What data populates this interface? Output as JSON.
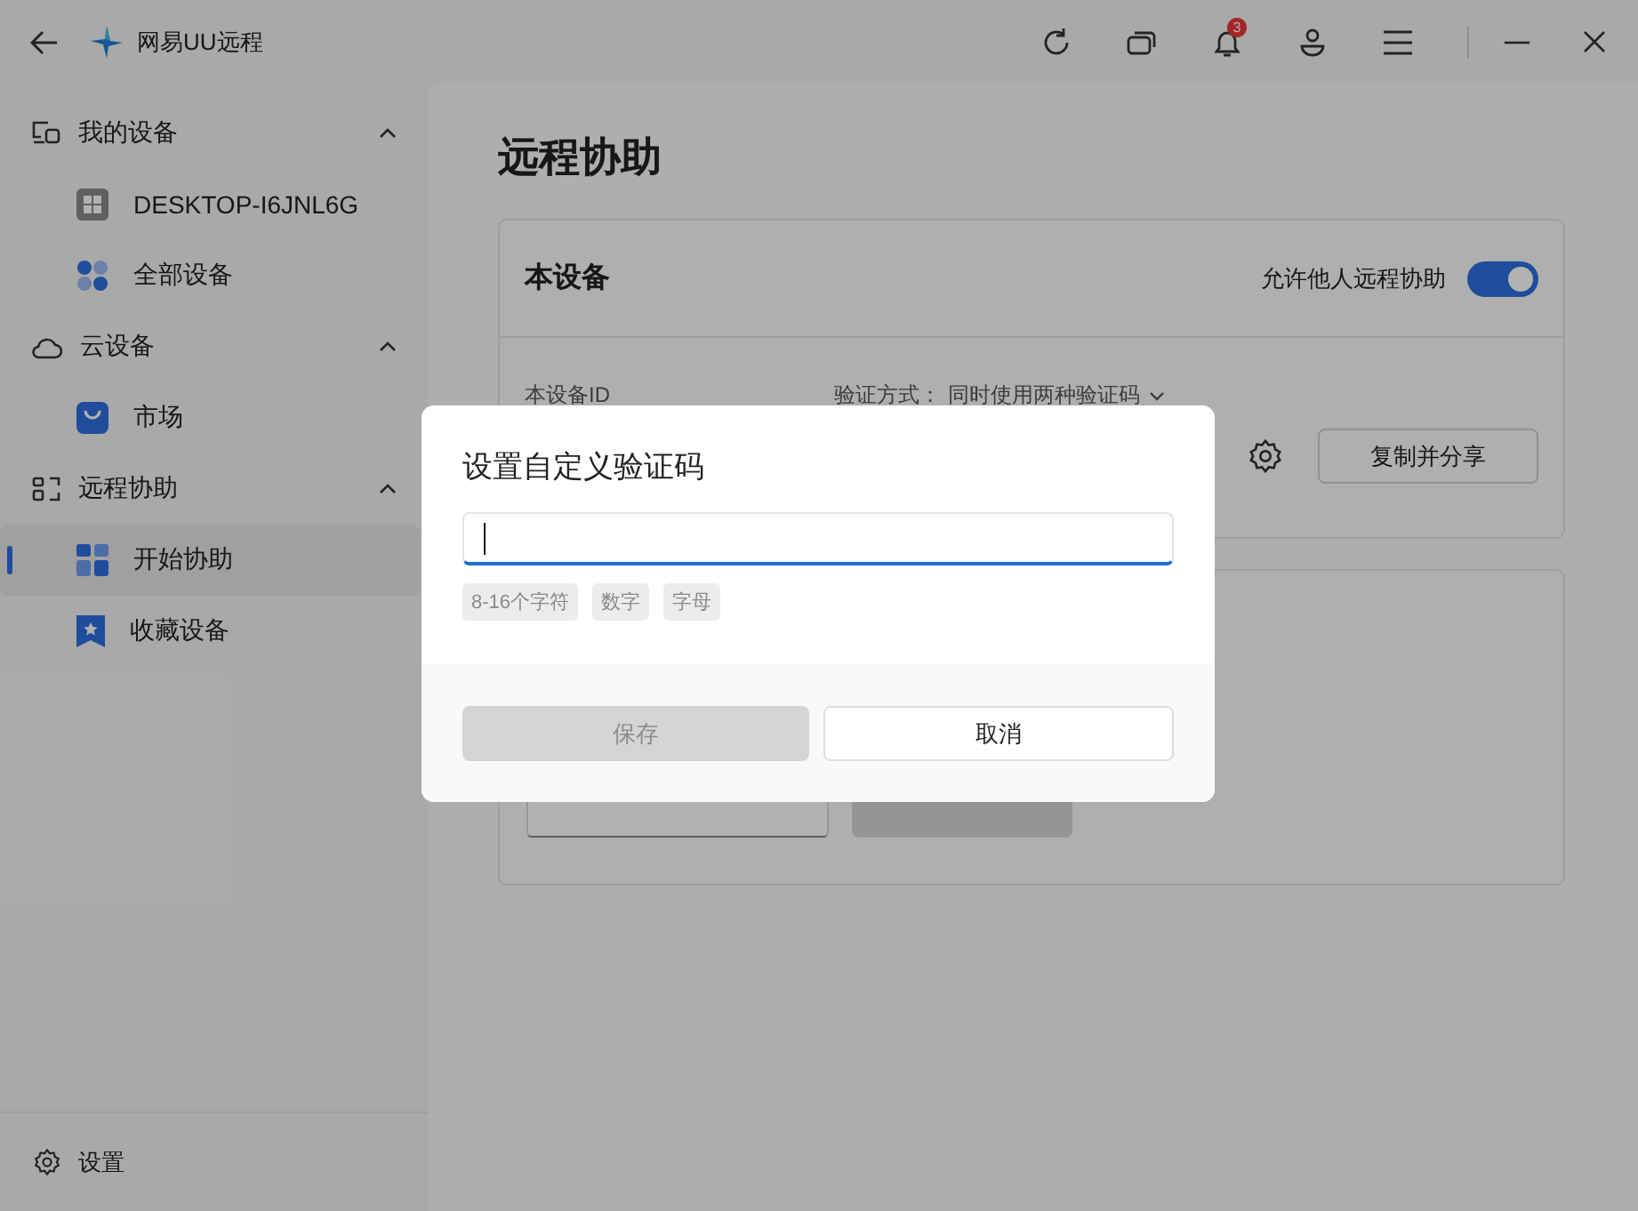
{
  "window": {
    "title": "网易UU远程",
    "notification_count": "3"
  },
  "sidebar": {
    "groups": [
      {
        "label": "我的设备",
        "expanded": true,
        "items": [
          {
            "label": "DESKTOP-I6JNL6G",
            "selected": false
          },
          {
            "label": "全部设备",
            "selected": false
          }
        ]
      },
      {
        "label": "云设备",
        "expanded": true,
        "items": [
          {
            "label": "市场",
            "selected": false
          }
        ]
      },
      {
        "label": "远程协助",
        "expanded": true,
        "items": [
          {
            "label": "开始协助",
            "selected": true
          },
          {
            "label": "收藏设备",
            "selected": false
          }
        ]
      }
    ],
    "footer": "设置"
  },
  "page": {
    "title": "远程协助",
    "device_card": {
      "title": "本设备",
      "allow_label": "允许他人远程协助",
      "allow_on": true,
      "id_label": "本设备ID",
      "verify_label": "验证方式：",
      "verify_value": "同时使用两种验证码",
      "share_button": "复制并分享"
    }
  },
  "dialog": {
    "title": "设置自定义验证码",
    "hints": [
      {
        "label": "8-16个字符",
        "met": false
      },
      {
        "label": "数字",
        "met": false
      },
      {
        "label": "字母",
        "met": false
      }
    ],
    "save_button": {
      "label": "保存",
      "disabled": true
    },
    "cancel_button": "取消"
  }
}
